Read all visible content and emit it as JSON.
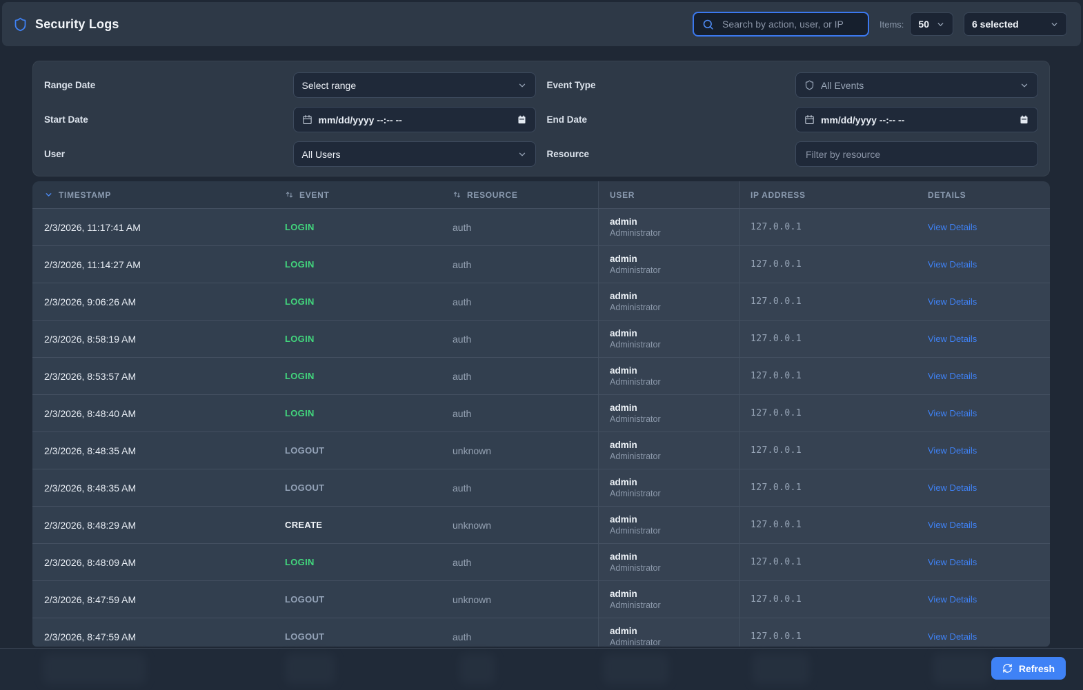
{
  "app": {
    "title": "Security Logs"
  },
  "header": {
    "search_placeholder": "Search by action, user, or IP",
    "items_label": "Items:",
    "page_size": "50",
    "columns_selected": "6 selected"
  },
  "filters": {
    "range_date": {
      "label": "Range Date",
      "value": "Select range"
    },
    "event_type": {
      "label": "Event Type",
      "value": "All Events"
    },
    "start_date": {
      "label": "Start Date",
      "value": "mm/dd/yyyy --:-- --"
    },
    "end_date": {
      "label": "End Date",
      "value": "mm/dd/yyyy --:-- --"
    },
    "user": {
      "label": "User",
      "value": "All Users"
    },
    "resource": {
      "label": "Resource",
      "placeholder": "Filter by resource"
    }
  },
  "table": {
    "columns": [
      {
        "key": "timestamp",
        "label": "TIMESTAMP",
        "sort": "desc"
      },
      {
        "key": "event",
        "label": "EVENT",
        "sort": "none"
      },
      {
        "key": "resource",
        "label": "RESOURCE",
        "sort": "none"
      },
      {
        "key": "user",
        "label": "USER"
      },
      {
        "key": "ip",
        "label": "IP ADDRESS"
      },
      {
        "key": "details",
        "label": "DETAILS"
      }
    ],
    "details_label": "View Details",
    "event_colors": {
      "LOGIN": "#42d77d",
      "LOGOUT": "#94a3b8",
      "CREATE": "#f1f5f9"
    },
    "rows": [
      {
        "timestamp": "2/3/2026, 11:17:41 AM",
        "event": "LOGIN",
        "resource": "auth",
        "user_name": "admin",
        "user_role": "Administrator",
        "ip": "127.0.0.1"
      },
      {
        "timestamp": "2/3/2026, 11:14:27 AM",
        "event": "LOGIN",
        "resource": "auth",
        "user_name": "admin",
        "user_role": "Administrator",
        "ip": "127.0.0.1"
      },
      {
        "timestamp": "2/3/2026, 9:06:26 AM",
        "event": "LOGIN",
        "resource": "auth",
        "user_name": "admin",
        "user_role": "Administrator",
        "ip": "127.0.0.1"
      },
      {
        "timestamp": "2/3/2026, 8:58:19 AM",
        "event": "LOGIN",
        "resource": "auth",
        "user_name": "admin",
        "user_role": "Administrator",
        "ip": "127.0.0.1"
      },
      {
        "timestamp": "2/3/2026, 8:53:57 AM",
        "event": "LOGIN",
        "resource": "auth",
        "user_name": "admin",
        "user_role": "Administrator",
        "ip": "127.0.0.1"
      },
      {
        "timestamp": "2/3/2026, 8:48:40 AM",
        "event": "LOGIN",
        "resource": "auth",
        "user_name": "admin",
        "user_role": "Administrator",
        "ip": "127.0.0.1"
      },
      {
        "timestamp": "2/3/2026, 8:48:35 AM",
        "event": "LOGOUT",
        "resource": "unknown",
        "user_name": "admin",
        "user_role": "Administrator",
        "ip": "127.0.0.1"
      },
      {
        "timestamp": "2/3/2026, 8:48:35 AM",
        "event": "LOGOUT",
        "resource": "auth",
        "user_name": "admin",
        "user_role": "Administrator",
        "ip": "127.0.0.1"
      },
      {
        "timestamp": "2/3/2026, 8:48:29 AM",
        "event": "CREATE",
        "resource": "unknown",
        "user_name": "admin",
        "user_role": "Administrator",
        "ip": "127.0.0.1"
      },
      {
        "timestamp": "2/3/2026, 8:48:09 AM",
        "event": "LOGIN",
        "resource": "auth",
        "user_name": "admin",
        "user_role": "Administrator",
        "ip": "127.0.0.1"
      },
      {
        "timestamp": "2/3/2026, 8:47:59 AM",
        "event": "LOGOUT",
        "resource": "unknown",
        "user_name": "admin",
        "user_role": "Administrator",
        "ip": "127.0.0.1"
      },
      {
        "timestamp": "2/3/2026, 8:47:59 AM",
        "event": "LOGOUT",
        "resource": "auth",
        "user_name": "admin",
        "user_role": "Administrator",
        "ip": "127.0.0.1"
      }
    ]
  },
  "footer": {
    "refresh_label": "Refresh"
  },
  "colors": {
    "accent": "#3f82f6",
    "login_green": "#42d77d",
    "header_bg": "#2e3947",
    "row_bg": "#323f4f",
    "page_bg": "#1f2835"
  }
}
